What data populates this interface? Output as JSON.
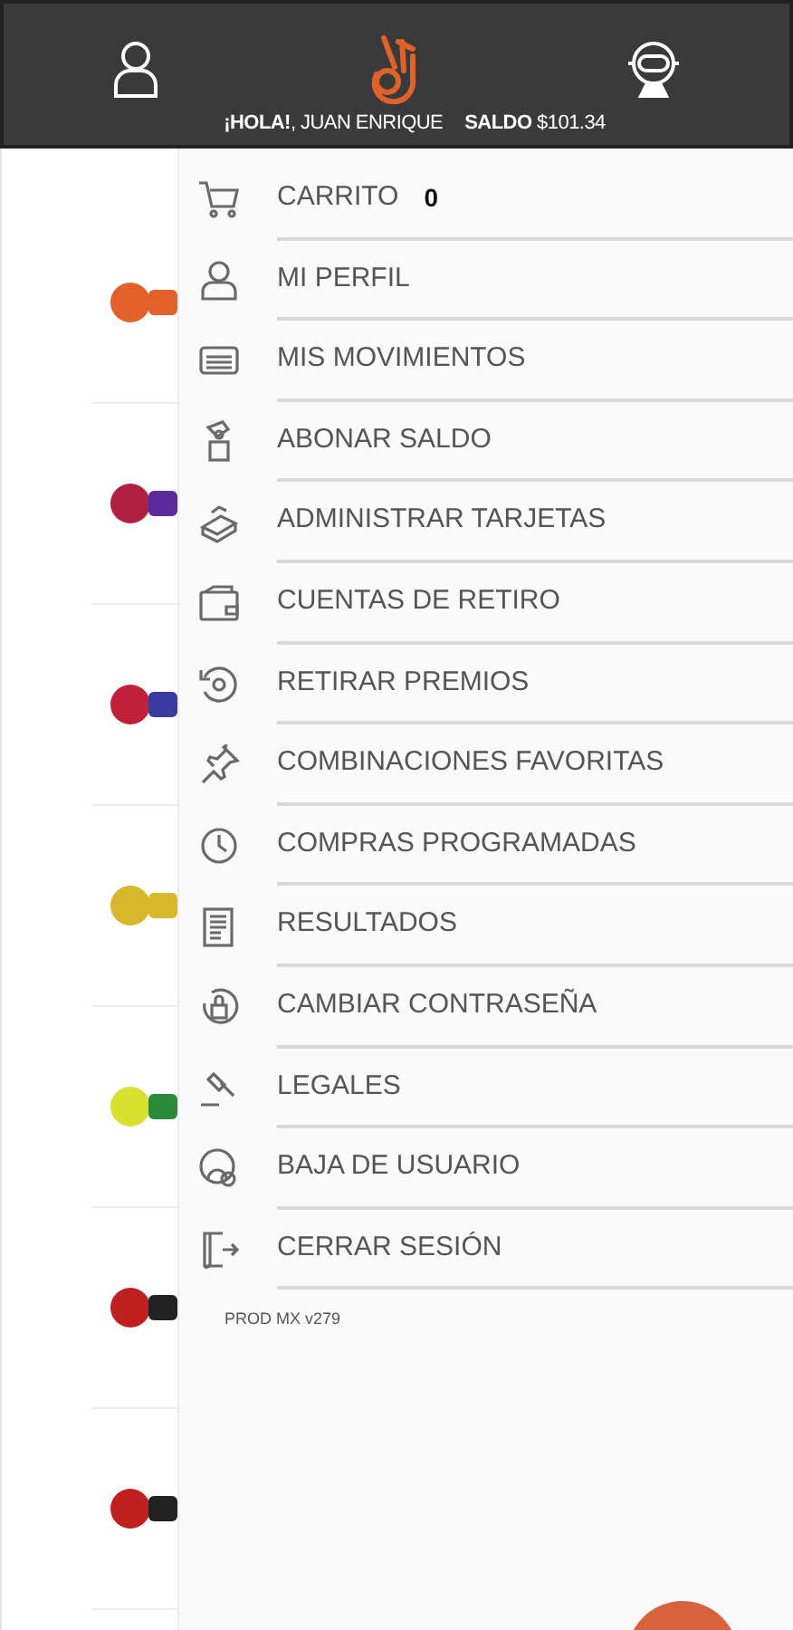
{
  "header": {
    "greeting": "**¡HOLA!**, JUAN ENRIQUE",
    "balance": "**SALDO** $101.34"
  },
  "menu": {
    "items": [
      {
        "label": "CARRITO",
        "count": "0"
      },
      {
        "label": "MI PERFIL"
      },
      {
        "label": "MIS MOVIMIENTOS"
      },
      {
        "label": "ABONAR SALDO"
      },
      {
        "label": "ADMINISTRAR TARJETAS"
      },
      {
        "label": "CUENTAS DE RETIRO"
      },
      {
        "label": "RETIRAR PREMIOS"
      },
      {
        "label": "COMBINACIONES FAVORITAS"
      },
      {
        "label": "COMPRAS PROGRAMADAS"
      },
      {
        "label": "RESULTADOS"
      },
      {
        "label": "CAMBIAR CONTRASEÑA"
      },
      {
        "label": "LEGALES"
      },
      {
        "label": "BAJA DE USUARIO"
      },
      {
        "label": "CERRAR SESIÓN"
      }
    ],
    "version": "PROD MX v279"
  }
}
